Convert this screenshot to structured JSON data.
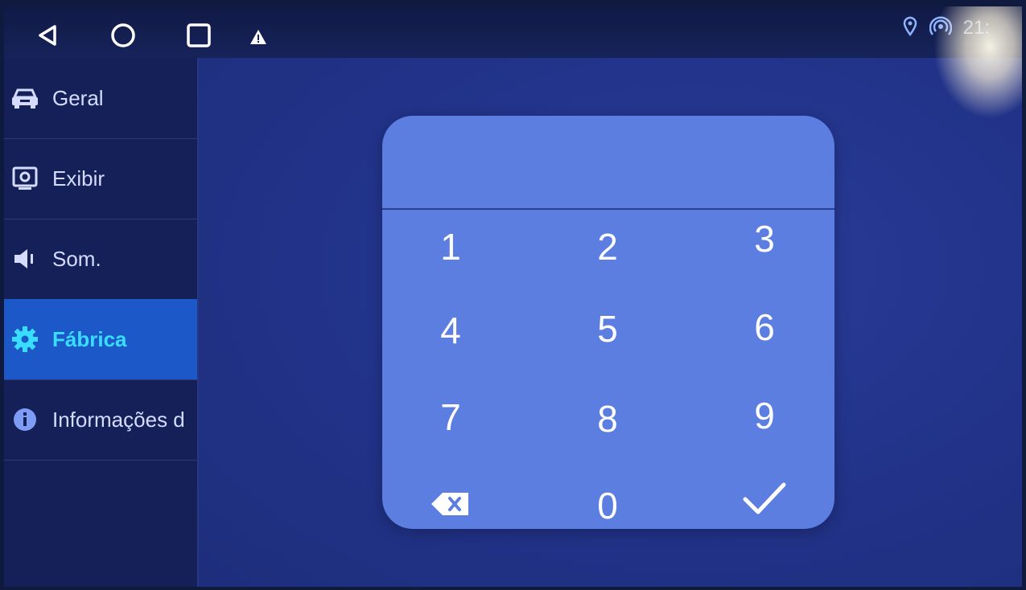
{
  "status": {
    "time": "21:",
    "nav": {
      "back": "back-icon",
      "home": "home-icon",
      "recents": "recents-icon"
    },
    "alert_icon": "warning-icon",
    "location_icon": "location-icon",
    "hotspot_icon": "hotspot-icon"
  },
  "sidebar": {
    "items": [
      {
        "label": "Geral",
        "icon": "car-icon"
      },
      {
        "label": "Exibir",
        "icon": "display-icon"
      },
      {
        "label": "Som.",
        "icon": "speaker-icon"
      },
      {
        "label": "Fábrica",
        "icon": "gear-icon",
        "active": true
      },
      {
        "label": "Informações d",
        "icon": "info-icon"
      }
    ]
  },
  "keypad": {
    "input_value": "",
    "keys": [
      "1",
      "2",
      "3",
      "4",
      "5",
      "6",
      "7",
      "8",
      "9",
      "0"
    ],
    "backspace_icon": "backspace-icon",
    "confirm_icon": "check-icon"
  },
  "colors": {
    "accent": "#39ddff",
    "active_bg": "#1c58c8",
    "dialog_bg": "#5b7ee0"
  }
}
